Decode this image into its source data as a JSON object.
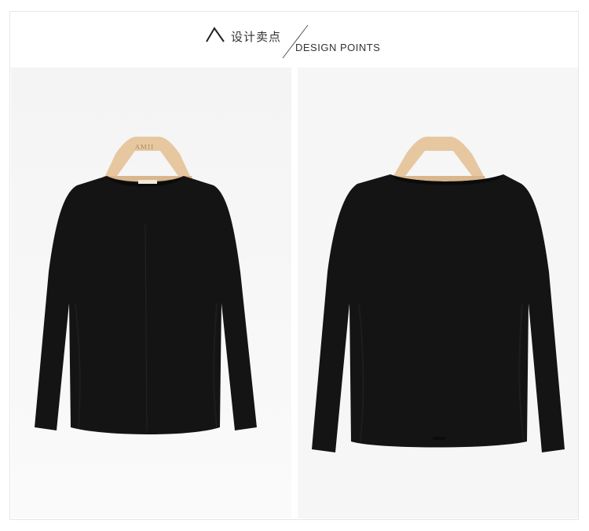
{
  "header": {
    "title_cn": "设计卖点",
    "title_en": "DESIGN POINTS"
  },
  "photos": {
    "front": {
      "hanger_brand": "AMII"
    }
  },
  "colors": {
    "garment": "#111111",
    "hanger": "#e4c39c",
    "background": "#f6f6f6"
  }
}
